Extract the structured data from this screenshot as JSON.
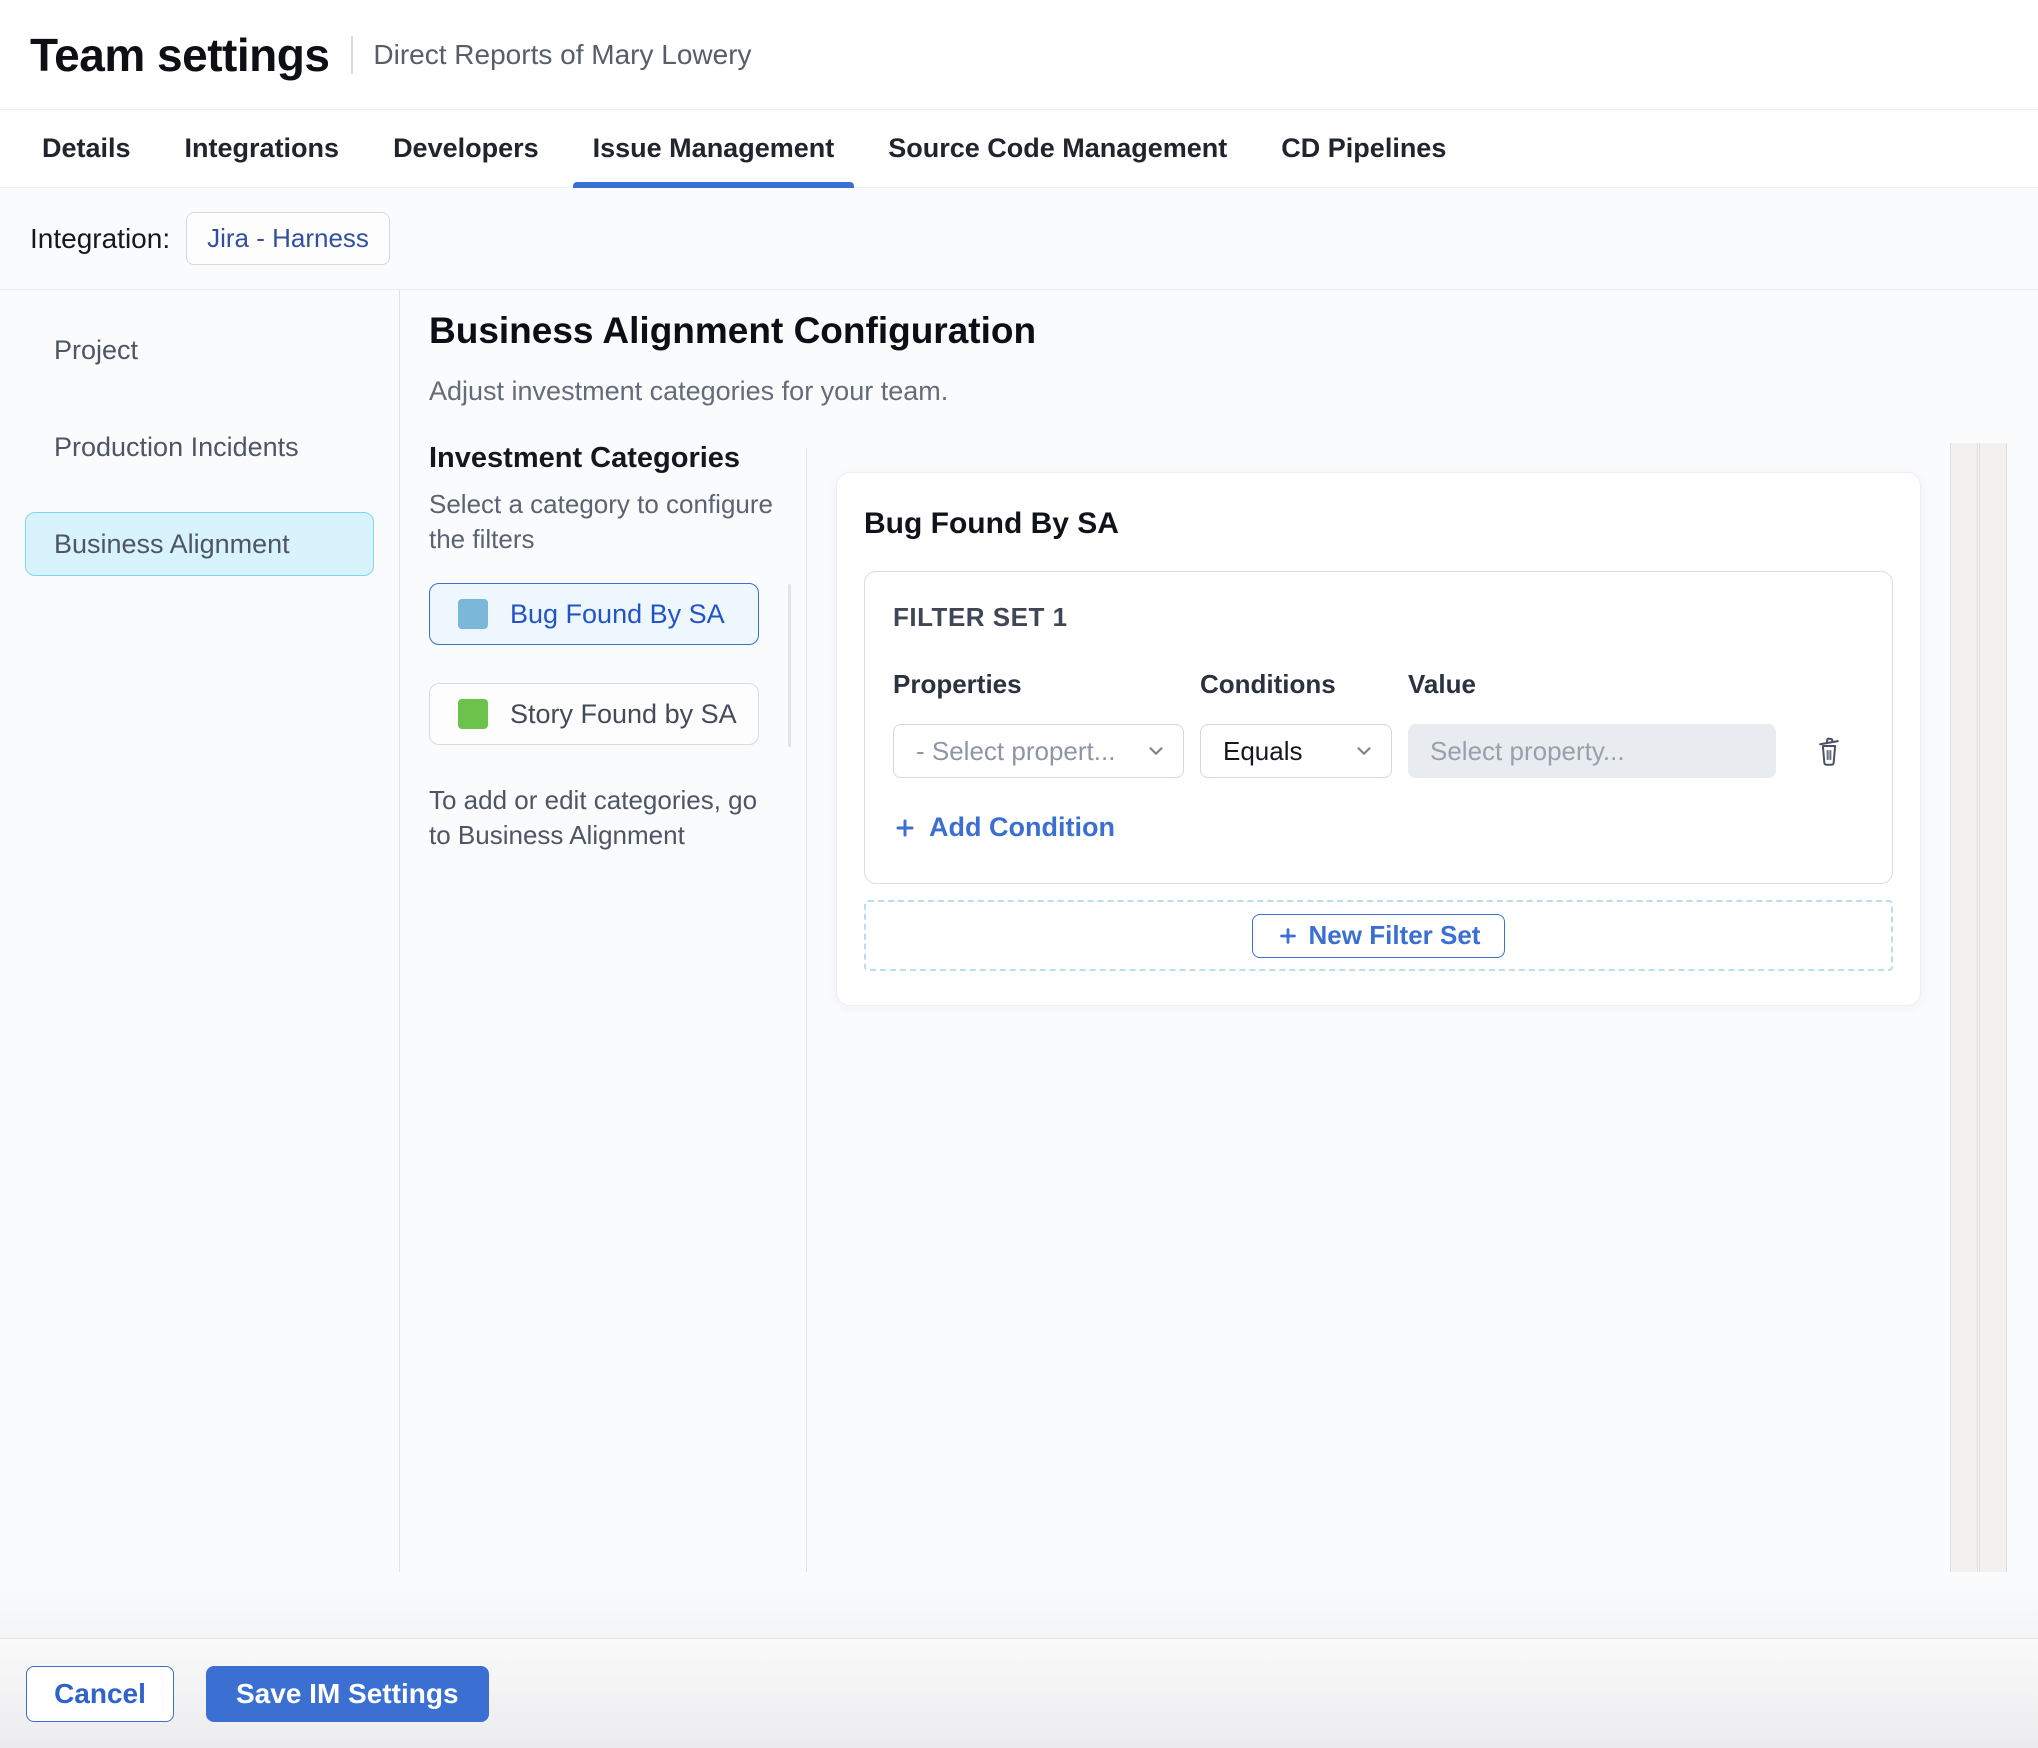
{
  "header": {
    "title": "Team settings",
    "subtitle": "Direct Reports of Mary Lowery"
  },
  "tabs": {
    "items": [
      {
        "label": "Details",
        "active": false
      },
      {
        "label": "Integrations",
        "active": false
      },
      {
        "label": "Developers",
        "active": false
      },
      {
        "label": "Issue Management",
        "active": true
      },
      {
        "label": "Source Code Management",
        "active": false
      },
      {
        "label": "CD Pipelines",
        "active": false
      }
    ]
  },
  "integration": {
    "label": "Integration:",
    "value": "Jira - Harness"
  },
  "sidebar": {
    "items": [
      {
        "label": "Project",
        "active": false
      },
      {
        "label": "Production Incidents",
        "active": false
      },
      {
        "label": "Business Alignment",
        "active": true
      }
    ]
  },
  "main": {
    "title": "Business Alignment Configuration",
    "subtitle": "Adjust investment categories for your team.",
    "categories": {
      "title": "Investment Categories",
      "description": "Select a category to configure the filters",
      "items": [
        {
          "label": "Bug Found By SA",
          "color": "#7ab7d9",
          "selected": true
        },
        {
          "label": "Story Found by SA",
          "color": "#6cc24a",
          "selected": false
        }
      ],
      "note": "To add or edit categories, go to Business Alignment"
    },
    "panel": {
      "title": "Bug Found By SA",
      "filter_set": {
        "title": "FILTER SET 1",
        "columns": [
          "Properties",
          "Conditions",
          "Value"
        ],
        "condition_row": {
          "property_placeholder": "- Select propert...",
          "condition_value": "Equals",
          "value_placeholder": "Select property..."
        },
        "add_condition_label": "Add Condition"
      },
      "new_filter_set_label": "New Filter Set"
    }
  },
  "footer": {
    "cancel_label": "Cancel",
    "save_label": "Save IM Settings"
  },
  "icons": {
    "chevron_down": "chevron-down-icon",
    "plus": "plus-icon",
    "trash": "trash-icon"
  },
  "colors": {
    "accent_blue": "#3b6fd1",
    "category_text_blue": "#2254c5",
    "selected_category_bg": "#eef7fd",
    "sidebar_active_bg": "#d8f3fb",
    "sidebar_active_border": "#82d7ec",
    "swatch_blue": "#7ab7d9",
    "swatch_green": "#6cc24a",
    "value_input_bg": "#e8ecf0",
    "page_bg": "#fafbfd"
  }
}
